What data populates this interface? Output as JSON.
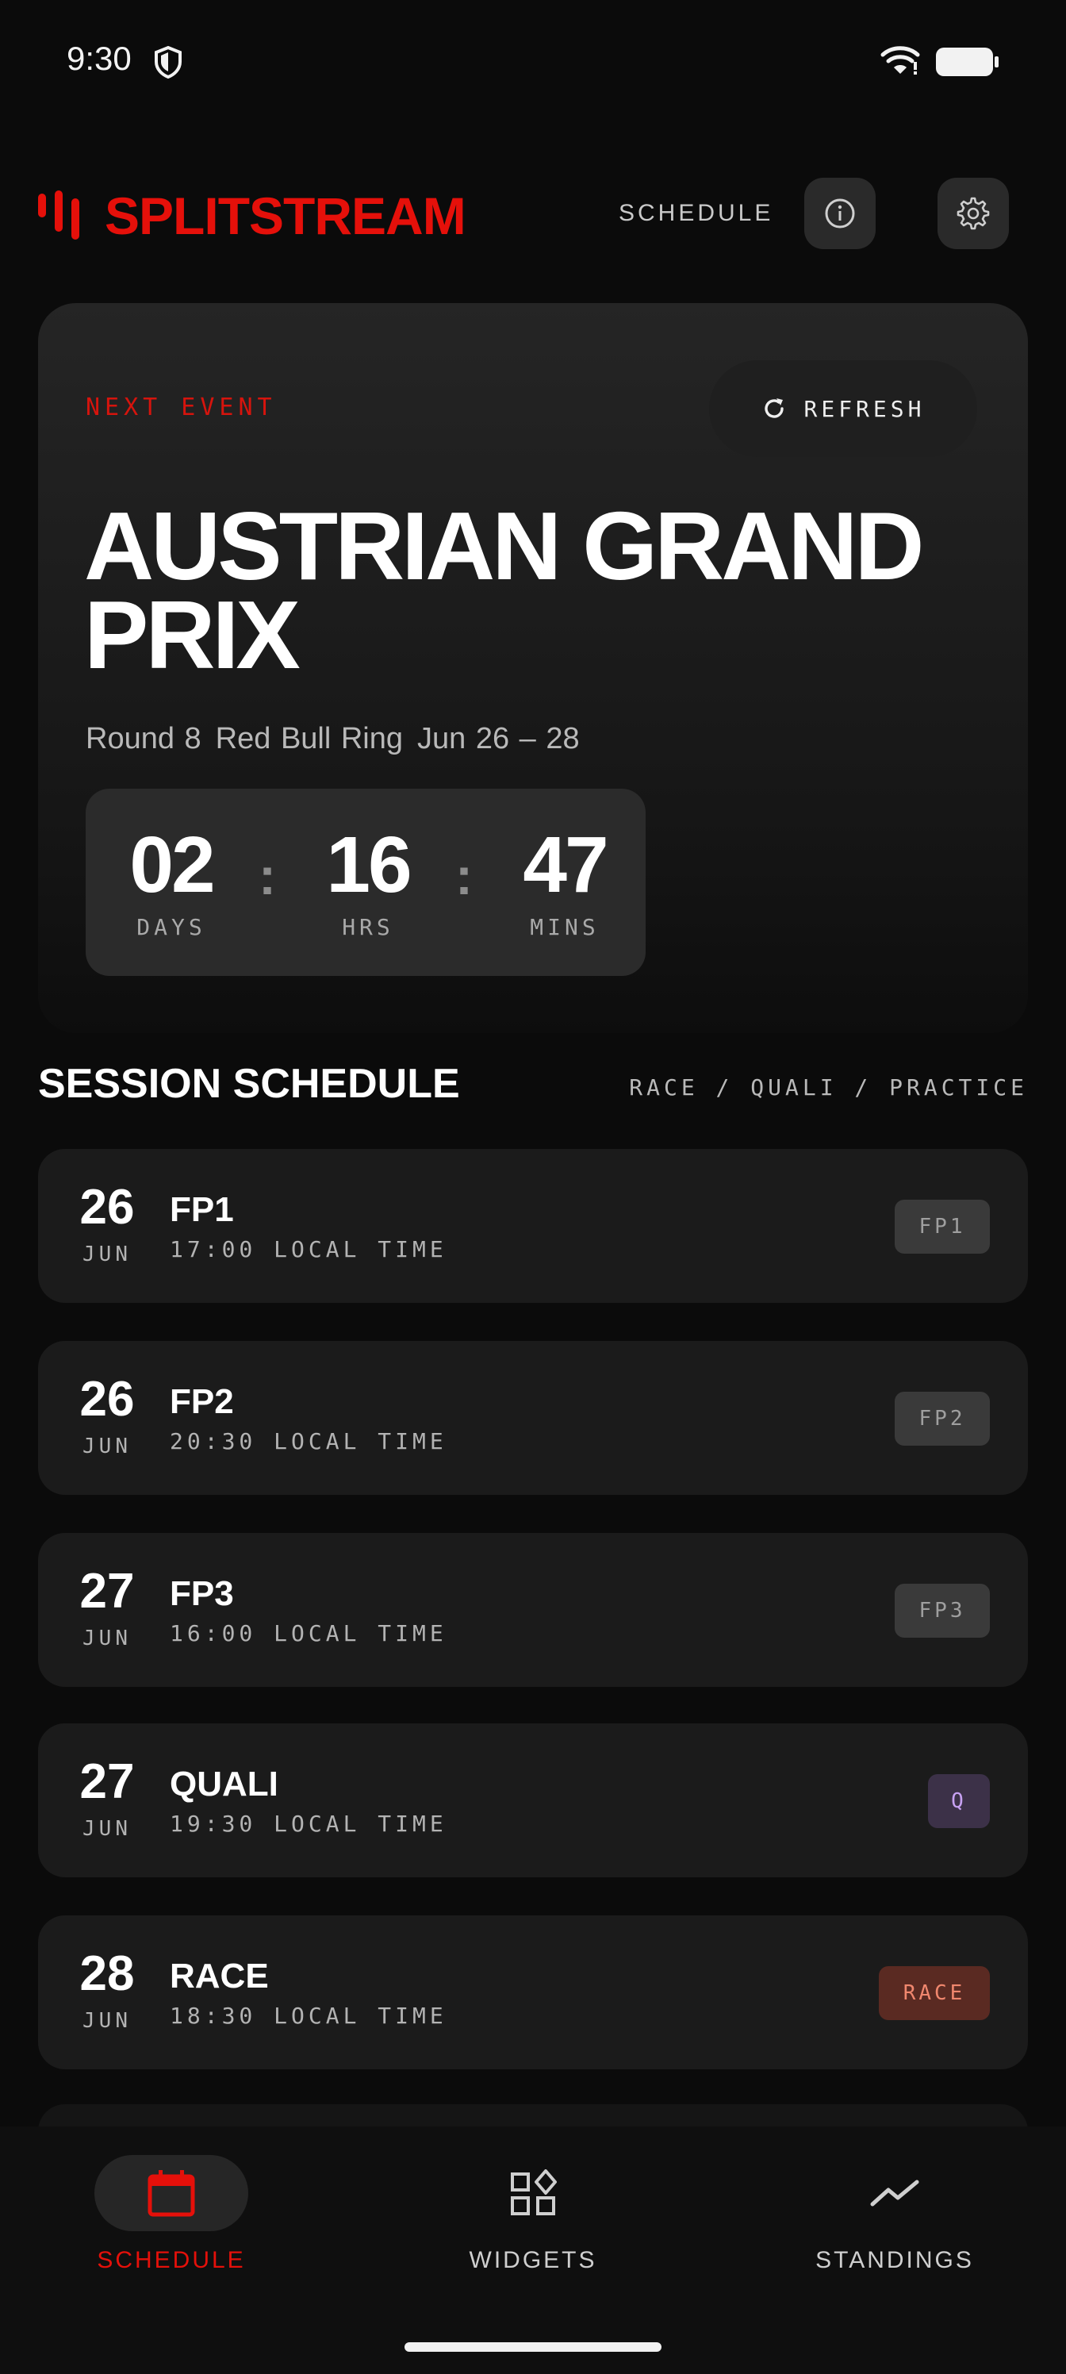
{
  "status_bar": {
    "time": "9:30"
  },
  "header": {
    "app_name": "SPLITSTREAM",
    "nav_link": "SCHEDULE",
    "brand_color": "#e5100a"
  },
  "next_event": {
    "label": "NEXT EVENT",
    "refresh_label": "REFRESH",
    "title": "AUSTRIAN GRAND PRIX",
    "round": "Round 8",
    "circuit": "Red Bull Ring",
    "dates": "Jun 26 – 28",
    "countdown": {
      "days": "02",
      "days_label": "DAYS",
      "hours": "16",
      "hours_label": "HRS",
      "mins": "47",
      "mins_label": "MINS"
    }
  },
  "schedule": {
    "title": "SESSION SCHEDULE",
    "filter": "RACE / QUALI / PRACTICE",
    "sessions": [
      {
        "day": "26",
        "month": "JUN",
        "name": "FP1",
        "time": "17:00 LOCAL TIME",
        "badge": "FP1",
        "badge_type": "practice"
      },
      {
        "day": "26",
        "month": "JUN",
        "name": "FP2",
        "time": "20:30 LOCAL TIME",
        "badge": "FP2",
        "badge_type": "practice"
      },
      {
        "day": "27",
        "month": "JUN",
        "name": "FP3",
        "time": "16:00 LOCAL TIME",
        "badge": "FP3",
        "badge_type": "practice"
      },
      {
        "day": "27",
        "month": "JUN",
        "name": "QUALI",
        "time": "19:30 LOCAL TIME",
        "badge": "Q",
        "badge_type": "quali"
      },
      {
        "day": "28",
        "month": "JUN",
        "name": "RACE",
        "time": "18:30 LOCAL TIME",
        "badge": "RACE",
        "badge_type": "race"
      }
    ]
  },
  "bottom_nav": {
    "items": [
      {
        "label": "SCHEDULE",
        "icon": "calendar-icon",
        "active": true
      },
      {
        "label": "WIDGETS",
        "icon": "widgets-icon",
        "active": false
      },
      {
        "label": "STANDINGS",
        "icon": "trend-icon",
        "active": false
      }
    ]
  }
}
